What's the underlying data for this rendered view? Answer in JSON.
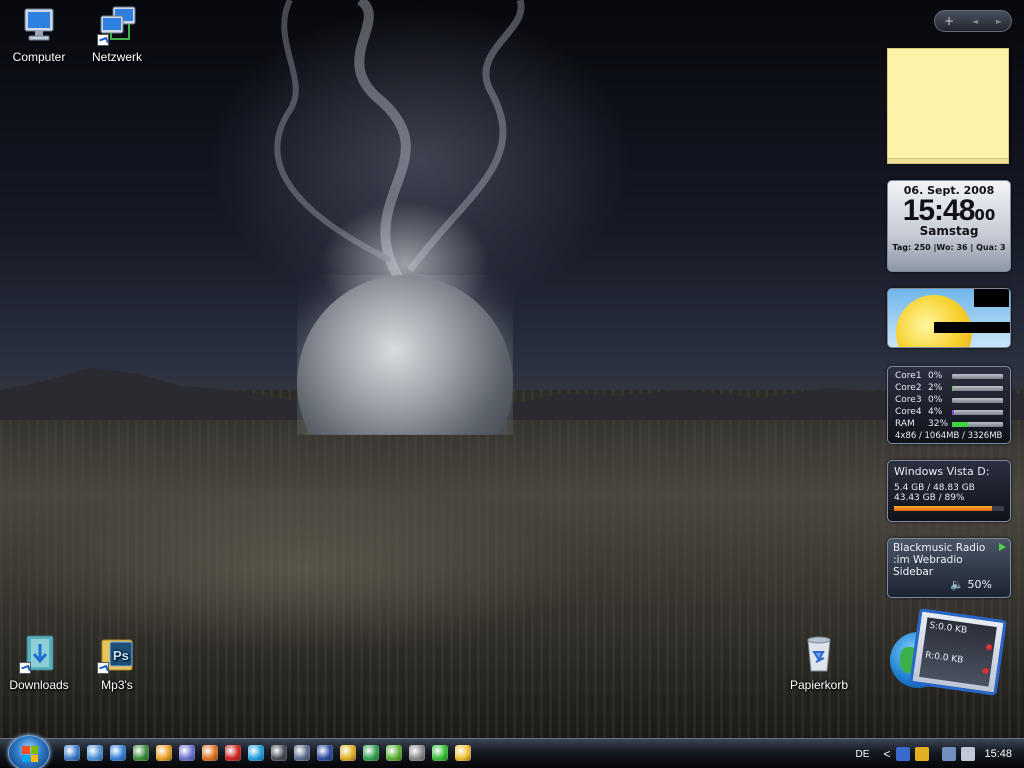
{
  "desktop": {
    "icons": [
      {
        "label": "Computer"
      },
      {
        "label": "Netzwerk"
      },
      {
        "label": "Downloads"
      },
      {
        "label": "Mp3's"
      },
      {
        "label": "Papierkorb"
      }
    ]
  },
  "sidebar": {
    "controls": {
      "add": "+",
      "prev": "◄",
      "next": "►"
    },
    "clock": {
      "date": "06. Sept. 2008",
      "time": "15:48",
      "seconds": "00",
      "day": "Samstag",
      "info": "Tag: 250 |Wo: 36 | Qua: 3"
    },
    "cpu": {
      "rows": [
        {
          "label": "Core1",
          "value": "0%",
          "percent": 0,
          "color": "#6ad04a"
        },
        {
          "label": "Core2",
          "value": "2%",
          "percent": 2,
          "color": "#6ad04a"
        },
        {
          "label": "Core3",
          "value": "0%",
          "percent": 0,
          "color": "#6ad04a"
        },
        {
          "label": "Core4",
          "value": "4%",
          "percent": 4,
          "color": "#a040e0"
        },
        {
          "label": "RAM",
          "value": "32%",
          "percent": 32,
          "color": "#3fd33f"
        }
      ],
      "footer": "4x86 / 1064MB / 3326MB"
    },
    "disk": {
      "title": "Windows Vista D:",
      "line1": "5.4 GB / 48.83 GB",
      "line2": "43.43 GB / 89%",
      "percent": 89
    },
    "radio": {
      "line1": "Blackmusic Radio",
      "line2": ":im Webradio Sidebar",
      "volume": "50%",
      "volume_icon": "🔈"
    },
    "network": {
      "sent": "S:0.0 KB",
      "received": "R:0.0 KB"
    }
  },
  "taskbar": {
    "language": "DE",
    "chevron": "<",
    "clock": "15:48",
    "quick_launch": [
      {
        "name": "show-desktop-icon",
        "color": "#3a78c8"
      },
      {
        "name": "switch-windows-icon",
        "color": "#4a90d8"
      },
      {
        "name": "internet-explorer-icon",
        "color": "#2e7fd8"
      },
      {
        "name": "app-green-icon",
        "color": "#3a8a3a"
      },
      {
        "name": "media-player-icon",
        "color": "#e8a020"
      },
      {
        "name": "orb-icon",
        "color": "#6a6fd0"
      },
      {
        "name": "firefox-icon",
        "color": "#e0701a"
      },
      {
        "name": "opera-icon",
        "color": "#d02020"
      },
      {
        "name": "skype-icon",
        "color": "#1fa0e0"
      },
      {
        "name": "steam-icon",
        "color": "#444a55"
      },
      {
        "name": "headphones-icon",
        "color": "#5a6a8a"
      },
      {
        "name": "tool-icon",
        "color": "#2a4aa0"
      },
      {
        "name": "pencil-icon",
        "color": "#e0b020"
      },
      {
        "name": "messenger-icon",
        "color": "#30a050"
      },
      {
        "name": "xbox-icon",
        "color": "#58b030"
      },
      {
        "name": "terminal-icon",
        "color": "#888888"
      },
      {
        "name": "clover-icon",
        "color": "#30c030"
      },
      {
        "name": "notes-icon",
        "color": "#f0c030"
      }
    ]
  },
  "colors": {
    "accent": "#2e79c7",
    "note": "#fdf3a8",
    "disk_bar": "#e06010"
  }
}
